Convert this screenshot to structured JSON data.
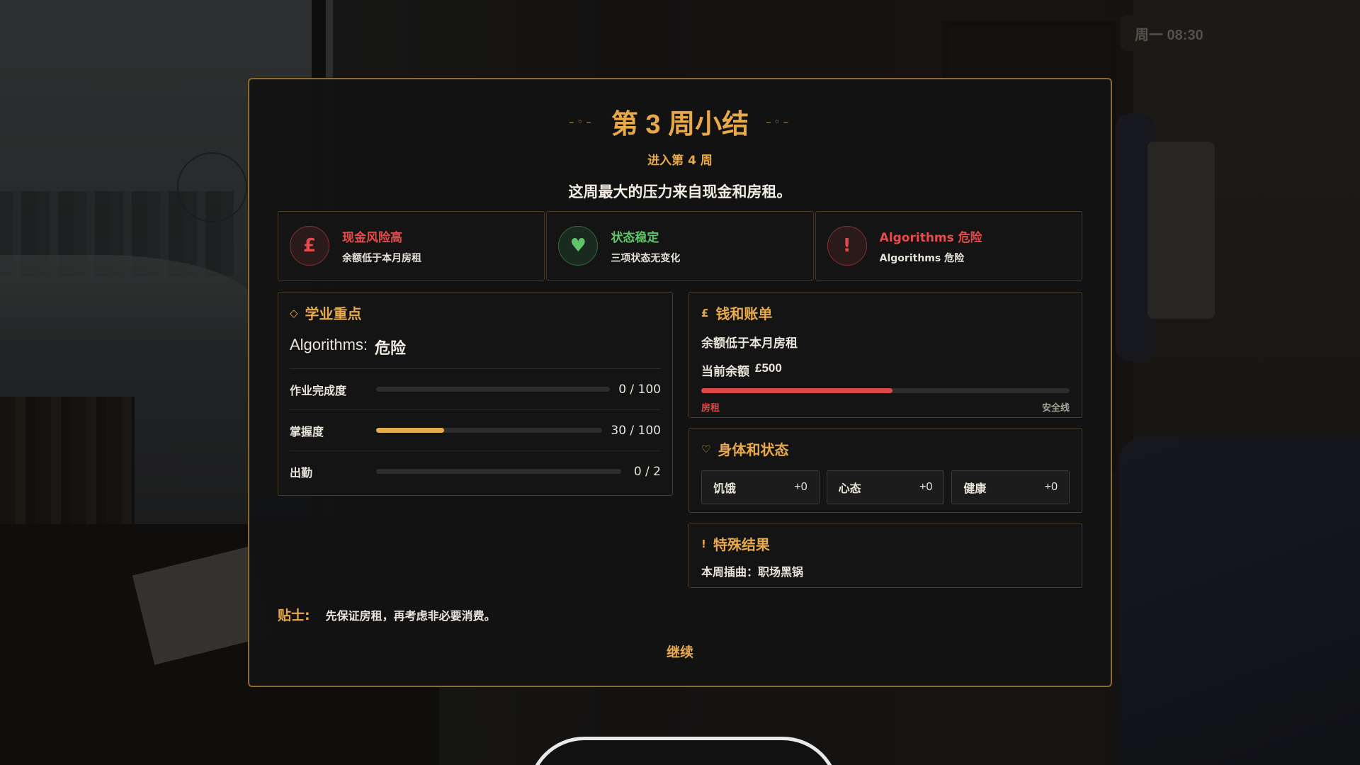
{
  "clock": "周一 08:30",
  "dialog": {
    "title": "第 3 周小结",
    "title_deco_left": "–◦–",
    "title_deco_right": "–◦–",
    "subtitle": "进入第 4 周",
    "headline": "这周最大的压力来自现金和房租。"
  },
  "status_cards": [
    {
      "icon": "pound-icon",
      "glyph": "£",
      "title": "现金风险高",
      "desc": "余额低于本月房租",
      "color": "#e44c4c"
    },
    {
      "icon": "heart-icon",
      "glyph": "♥",
      "title": "状态稳定",
      "desc": "三项状态无变化",
      "color": "#5fc46a"
    },
    {
      "icon": "exclamation-icon",
      "glyph": "!",
      "title": "Algorithms 危险",
      "desc": "Algorithms 危险",
      "color": "#e44c4c"
    }
  ],
  "study": {
    "icon": "diamond-icon",
    "icon_glyph": "◇",
    "title": "学业重点",
    "course_name": "Algorithms:",
    "course_status": "危险",
    "metrics": [
      {
        "label": "作业完成度",
        "value_text": "0 / 100",
        "progress": 0.0
      },
      {
        "label": "掌握度",
        "value_text": "30 / 100",
        "progress": 0.3
      },
      {
        "label": "出勤",
        "value_text": "0 / 2",
        "progress": 0.0
      }
    ]
  },
  "money": {
    "icon_glyph": "£",
    "title": "钱和账单",
    "line1": "余额低于本月房租",
    "balance_label": "当前余额",
    "balance_value": "£500",
    "bar_progress": 0.52,
    "bar_left_label": "房租",
    "bar_right_label": "安全线"
  },
  "body": {
    "icon_glyph": "♡",
    "title": "身体和状态",
    "stats": [
      {
        "label": "饥饿",
        "delta": "+0"
      },
      {
        "label": "心态",
        "delta": "+0"
      },
      {
        "label": "健康",
        "delta": "+0"
      }
    ]
  },
  "special": {
    "icon_glyph": "!",
    "title": "特殊结果",
    "line": "本周插曲：职场黑锅"
  },
  "tip": {
    "label": "贴士:",
    "text": "先保证房租，再考虑非必要消费。"
  },
  "continue_label": "继续",
  "colors": {
    "accent": "#e8a94a",
    "danger": "#e44c4c",
    "ok": "#5fc46a",
    "border": "#8c6a2c"
  }
}
